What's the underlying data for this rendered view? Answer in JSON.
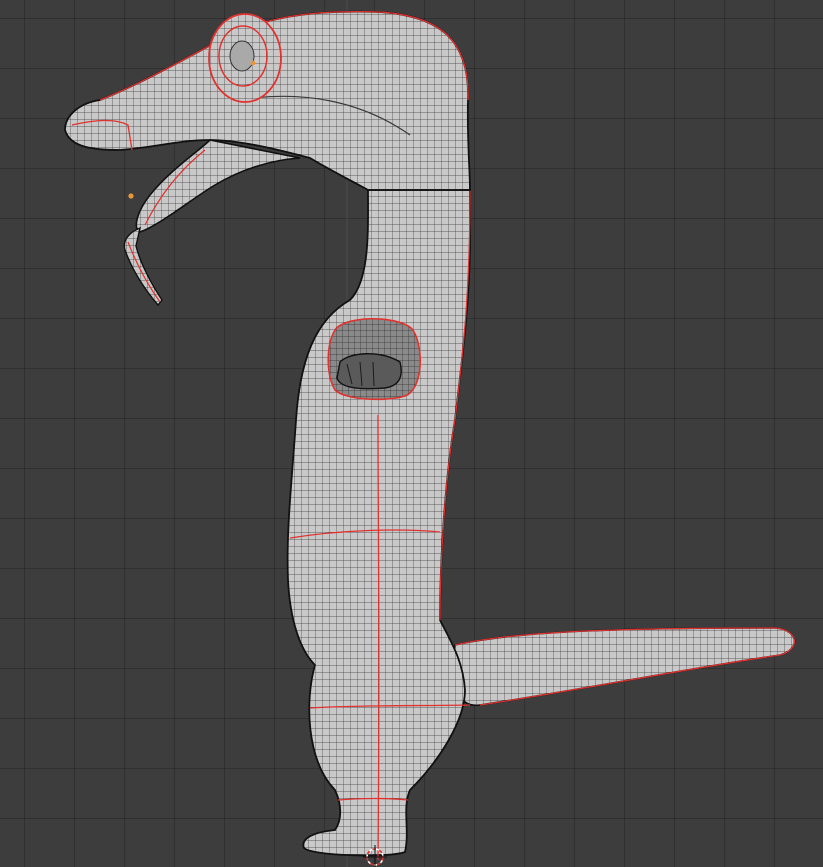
{
  "viewport": {
    "background_color": "#3d3d3d",
    "grid_color": "#303030",
    "axis_line_color": "#4a4a4a"
  },
  "model": {
    "surface_color": "#c9c9c9",
    "wire_color": "#2a2a2a",
    "seam_color": "#e0322f",
    "silhouette_color": "#111111"
  },
  "markers": {
    "origin_color": "#e8963a",
    "cursor_colors": [
      "#e0322f",
      "#ffffff"
    ]
  }
}
